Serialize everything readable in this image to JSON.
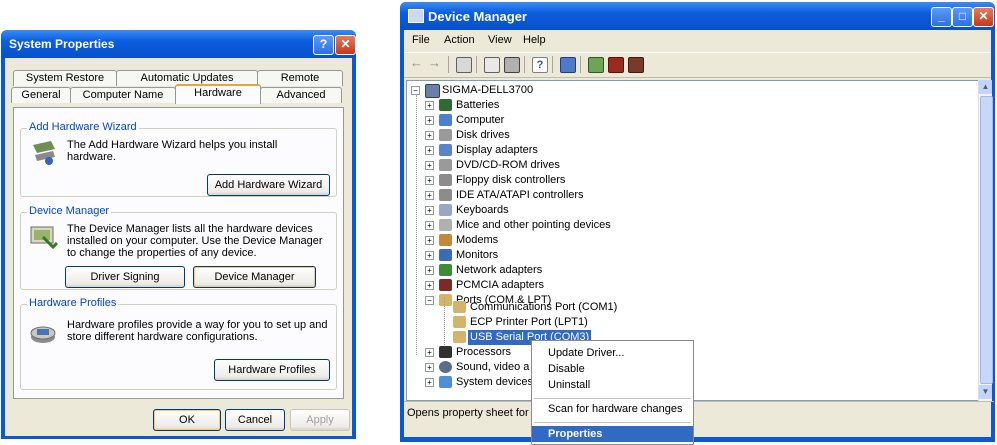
{
  "system_properties": {
    "title": "System Properties",
    "help_btn": "?",
    "close_btn": "✕",
    "tabs_back": [
      "System Restore",
      "Automatic Updates",
      "Remote"
    ],
    "tabs_front": [
      "General",
      "Computer Name",
      "Hardware",
      "Advanced"
    ],
    "selected_tab": "Hardware",
    "add_hw": {
      "group": "Add Hardware Wizard",
      "text": "The Add Hardware Wizard helps you install hardware.",
      "button": "Add Hardware Wizard"
    },
    "dev_mgr": {
      "group": "Device Manager",
      "text": "The Device Manager lists all the hardware devices installed on your computer. Use the Device Manager to change the properties of any device.",
      "btn_signing": "Driver Signing",
      "btn_devmgr": "Device Manager"
    },
    "hw_profiles": {
      "group": "Hardware Profiles",
      "text": "Hardware profiles provide a way for you to set up and store different hardware configurations.",
      "button": "Hardware Profiles"
    },
    "ok": "OK",
    "cancel": "Cancel",
    "apply": "Apply"
  },
  "device_manager": {
    "title": "Device Manager",
    "window_buttons": {
      "min": "_",
      "max": "□",
      "close": "✕"
    },
    "menu": [
      "File",
      "Action",
      "View",
      "Help"
    ],
    "toolbar_icons": [
      "back-icon",
      "forward-icon",
      "show-hide-tree-icon",
      "properties-icon",
      "print-icon",
      "help-icon",
      "scan-icon",
      "update-driver-icon",
      "uninstall-icon",
      "disable-icon"
    ],
    "tree": {
      "root": "SIGMA-DELL3700",
      "categories": [
        "Batteries",
        "Computer",
        "Disk drives",
        "Display adapters",
        "DVD/CD-ROM drives",
        "Floppy disk controllers",
        "IDE ATA/ATAPI controllers",
        "Keyboards",
        "Mice and other pointing devices",
        "Modems",
        "Monitors",
        "Network adapters",
        "PCMCIA adapters",
        "Ports (COM & LPT)"
      ],
      "ports_children": [
        "Communications Port (COM1)",
        "ECP Printer Port (LPT1)",
        "USB Serial Port (COM3)"
      ],
      "after": [
        "Processors",
        "Sound, video a",
        "System devices"
      ]
    },
    "status": "Opens property sheet for t",
    "context_menu": [
      "Update Driver...",
      "Disable",
      "Uninstall",
      "Scan for hardware changes",
      "Properties"
    ]
  }
}
